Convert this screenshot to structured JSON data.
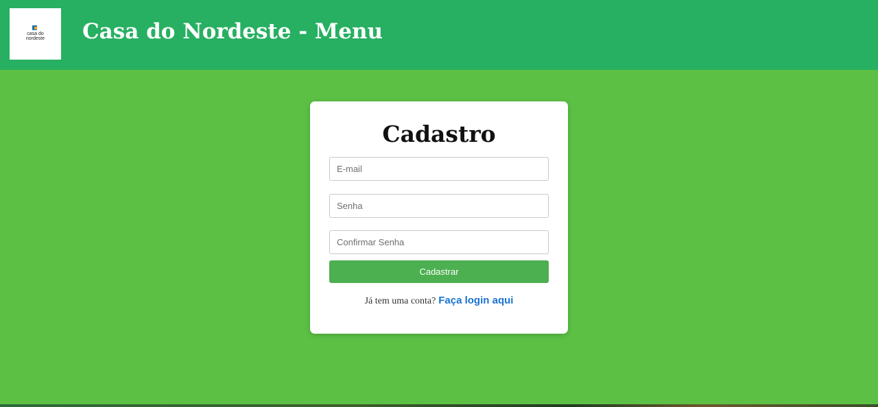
{
  "header": {
    "logo_text_line1": "casa do",
    "logo_text_line2": "nordeste",
    "title": "Casa do Nordeste - Menu"
  },
  "signup": {
    "title": "Cadastro",
    "email_placeholder": "E-mail",
    "password_placeholder": "Senha",
    "confirm_placeholder": "Confirmar Senha",
    "submit_label": "Cadastrar",
    "login_prompt": "Já tem uma conta?",
    "login_link": "Faça login aqui"
  },
  "colors": {
    "header_bg": "#27b062",
    "page_bg": "#5cc045",
    "button_bg": "#4caf50",
    "link": "#1a73d0"
  }
}
